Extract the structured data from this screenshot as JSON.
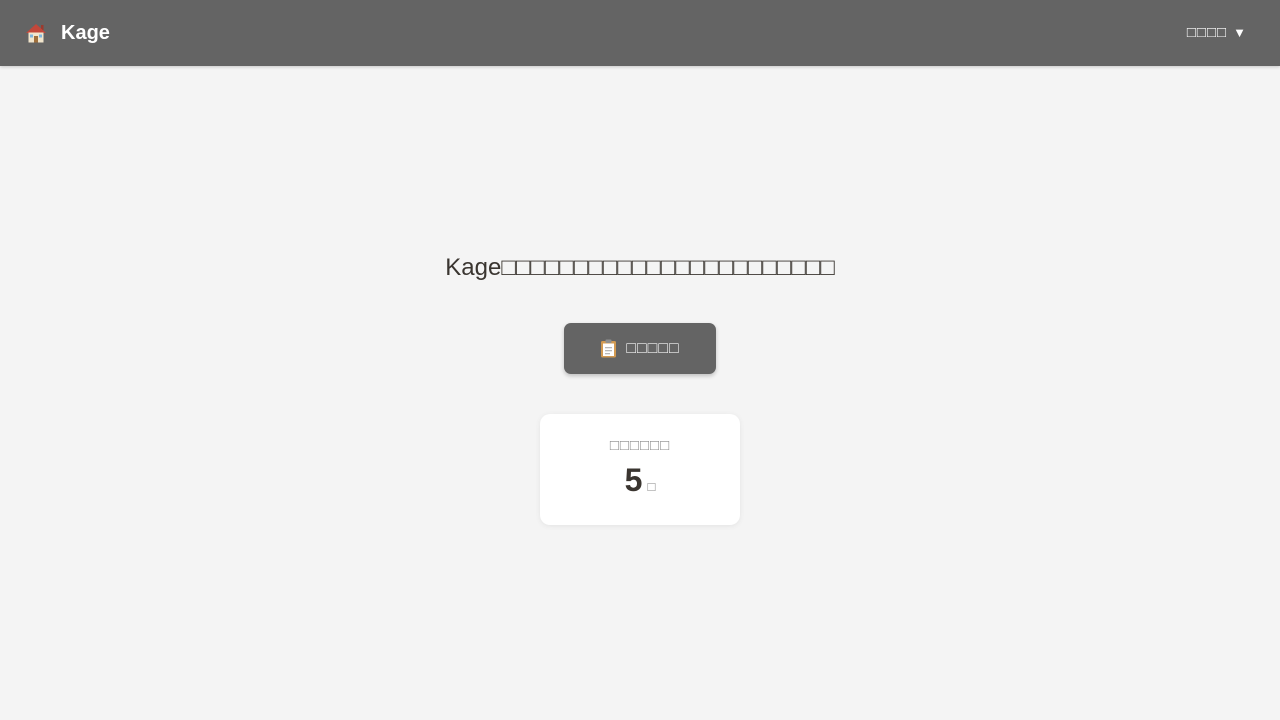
{
  "header": {
    "app_name": "Kage",
    "home_icon": "house-icon",
    "user_menu_label": "□□□□",
    "user_menu_caret": "▼"
  },
  "main": {
    "welcome_text": "Kage□□□□□□□□□□□□□□□□□□□□□□□",
    "primary_button": {
      "icon": "clipboard-icon",
      "label": "□□□□□"
    },
    "stat_card": {
      "label": "□□□□□□",
      "value": "5",
      "unit": "□"
    }
  },
  "colors": {
    "header_bg": "#646464",
    "page_bg": "#f4f4f4",
    "button_bg": "#646464",
    "card_bg": "#ffffff",
    "text_dark": "#3a3530",
    "text_muted": "#8a8a8a"
  }
}
